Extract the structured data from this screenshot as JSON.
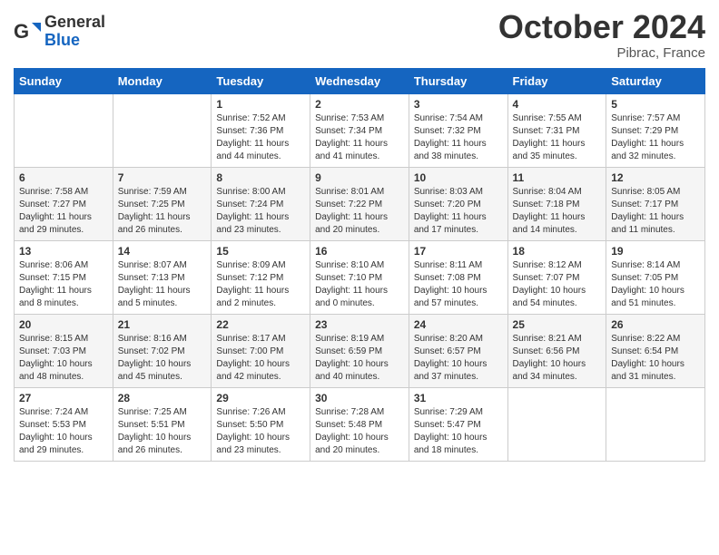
{
  "header": {
    "logo_general": "General",
    "logo_blue": "Blue",
    "month_title": "October 2024",
    "location": "Pibrac, France"
  },
  "days_of_week": [
    "Sunday",
    "Monday",
    "Tuesday",
    "Wednesday",
    "Thursday",
    "Friday",
    "Saturday"
  ],
  "weeks": [
    [
      {
        "day": "",
        "info": ""
      },
      {
        "day": "",
        "info": ""
      },
      {
        "day": "1",
        "info": "Sunrise: 7:52 AM\nSunset: 7:36 PM\nDaylight: 11 hours and 44 minutes."
      },
      {
        "day": "2",
        "info": "Sunrise: 7:53 AM\nSunset: 7:34 PM\nDaylight: 11 hours and 41 minutes."
      },
      {
        "day": "3",
        "info": "Sunrise: 7:54 AM\nSunset: 7:32 PM\nDaylight: 11 hours and 38 minutes."
      },
      {
        "day": "4",
        "info": "Sunrise: 7:55 AM\nSunset: 7:31 PM\nDaylight: 11 hours and 35 minutes."
      },
      {
        "day": "5",
        "info": "Sunrise: 7:57 AM\nSunset: 7:29 PM\nDaylight: 11 hours and 32 minutes."
      }
    ],
    [
      {
        "day": "6",
        "info": "Sunrise: 7:58 AM\nSunset: 7:27 PM\nDaylight: 11 hours and 29 minutes."
      },
      {
        "day": "7",
        "info": "Sunrise: 7:59 AM\nSunset: 7:25 PM\nDaylight: 11 hours and 26 minutes."
      },
      {
        "day": "8",
        "info": "Sunrise: 8:00 AM\nSunset: 7:24 PM\nDaylight: 11 hours and 23 minutes."
      },
      {
        "day": "9",
        "info": "Sunrise: 8:01 AM\nSunset: 7:22 PM\nDaylight: 11 hours and 20 minutes."
      },
      {
        "day": "10",
        "info": "Sunrise: 8:03 AM\nSunset: 7:20 PM\nDaylight: 11 hours and 17 minutes."
      },
      {
        "day": "11",
        "info": "Sunrise: 8:04 AM\nSunset: 7:18 PM\nDaylight: 11 hours and 14 minutes."
      },
      {
        "day": "12",
        "info": "Sunrise: 8:05 AM\nSunset: 7:17 PM\nDaylight: 11 hours and 11 minutes."
      }
    ],
    [
      {
        "day": "13",
        "info": "Sunrise: 8:06 AM\nSunset: 7:15 PM\nDaylight: 11 hours and 8 minutes."
      },
      {
        "day": "14",
        "info": "Sunrise: 8:07 AM\nSunset: 7:13 PM\nDaylight: 11 hours and 5 minutes."
      },
      {
        "day": "15",
        "info": "Sunrise: 8:09 AM\nSunset: 7:12 PM\nDaylight: 11 hours and 2 minutes."
      },
      {
        "day": "16",
        "info": "Sunrise: 8:10 AM\nSunset: 7:10 PM\nDaylight: 11 hours and 0 minutes."
      },
      {
        "day": "17",
        "info": "Sunrise: 8:11 AM\nSunset: 7:08 PM\nDaylight: 10 hours and 57 minutes."
      },
      {
        "day": "18",
        "info": "Sunrise: 8:12 AM\nSunset: 7:07 PM\nDaylight: 10 hours and 54 minutes."
      },
      {
        "day": "19",
        "info": "Sunrise: 8:14 AM\nSunset: 7:05 PM\nDaylight: 10 hours and 51 minutes."
      }
    ],
    [
      {
        "day": "20",
        "info": "Sunrise: 8:15 AM\nSunset: 7:03 PM\nDaylight: 10 hours and 48 minutes."
      },
      {
        "day": "21",
        "info": "Sunrise: 8:16 AM\nSunset: 7:02 PM\nDaylight: 10 hours and 45 minutes."
      },
      {
        "day": "22",
        "info": "Sunrise: 8:17 AM\nSunset: 7:00 PM\nDaylight: 10 hours and 42 minutes."
      },
      {
        "day": "23",
        "info": "Sunrise: 8:19 AM\nSunset: 6:59 PM\nDaylight: 10 hours and 40 minutes."
      },
      {
        "day": "24",
        "info": "Sunrise: 8:20 AM\nSunset: 6:57 PM\nDaylight: 10 hours and 37 minutes."
      },
      {
        "day": "25",
        "info": "Sunrise: 8:21 AM\nSunset: 6:56 PM\nDaylight: 10 hours and 34 minutes."
      },
      {
        "day": "26",
        "info": "Sunrise: 8:22 AM\nSunset: 6:54 PM\nDaylight: 10 hours and 31 minutes."
      }
    ],
    [
      {
        "day": "27",
        "info": "Sunrise: 7:24 AM\nSunset: 5:53 PM\nDaylight: 10 hours and 29 minutes."
      },
      {
        "day": "28",
        "info": "Sunrise: 7:25 AM\nSunset: 5:51 PM\nDaylight: 10 hours and 26 minutes."
      },
      {
        "day": "29",
        "info": "Sunrise: 7:26 AM\nSunset: 5:50 PM\nDaylight: 10 hours and 23 minutes."
      },
      {
        "day": "30",
        "info": "Sunrise: 7:28 AM\nSunset: 5:48 PM\nDaylight: 10 hours and 20 minutes."
      },
      {
        "day": "31",
        "info": "Sunrise: 7:29 AM\nSunset: 5:47 PM\nDaylight: 10 hours and 18 minutes."
      },
      {
        "day": "",
        "info": ""
      },
      {
        "day": "",
        "info": ""
      }
    ]
  ]
}
